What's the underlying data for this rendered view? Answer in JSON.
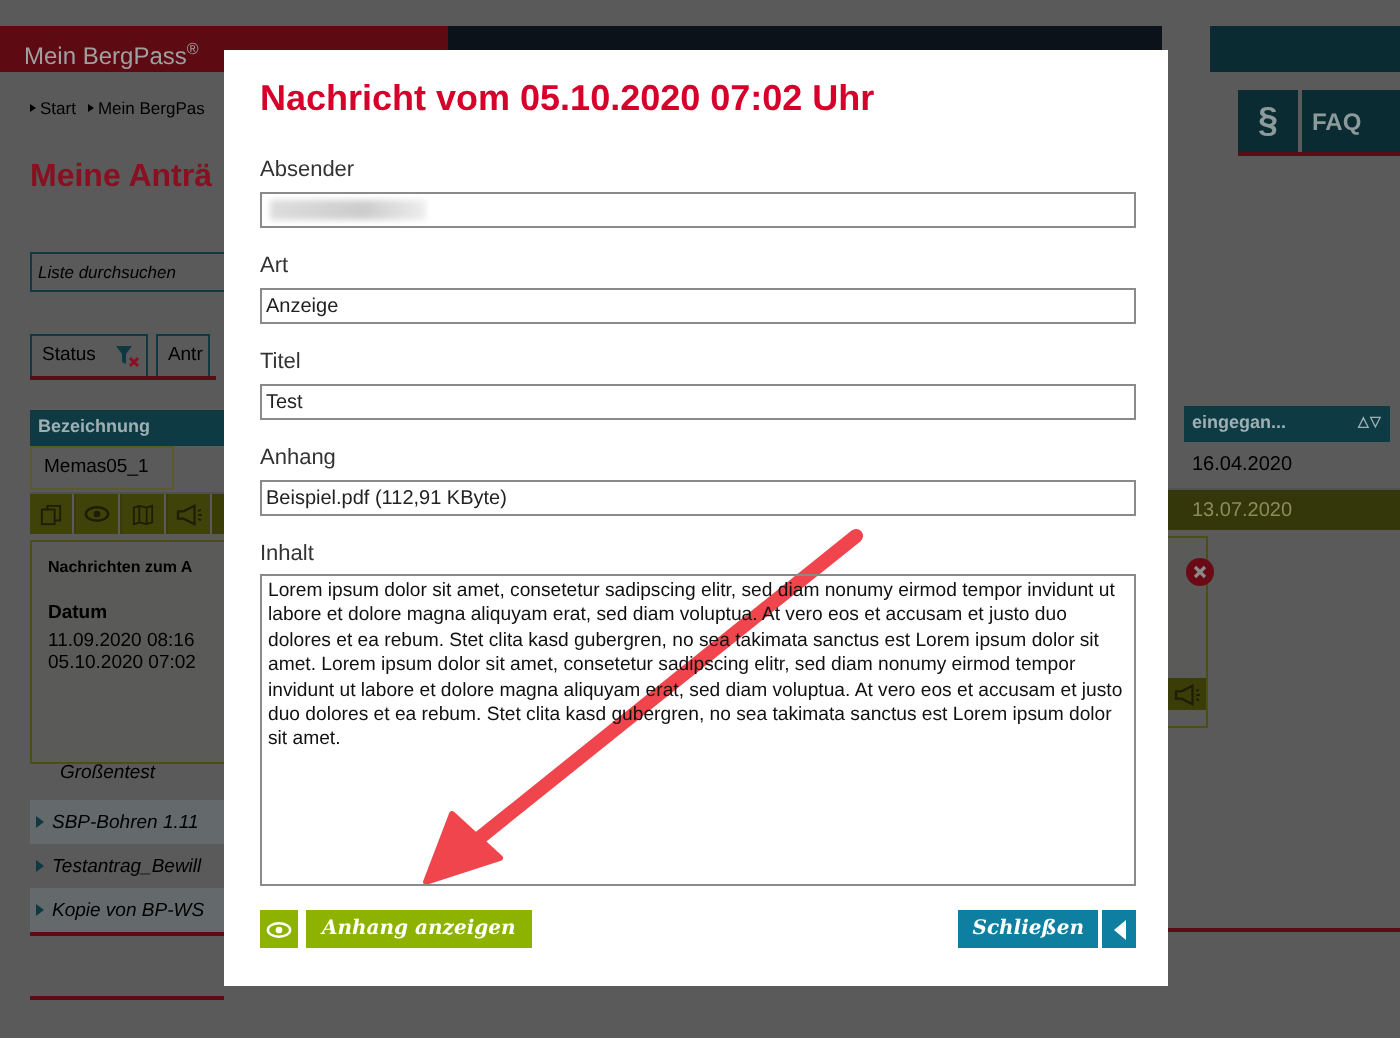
{
  "header": {
    "brand": "Mein BergPass$^{®}$",
    "tiles": [
      "§",
      "FAQ"
    ]
  },
  "breadcrumb": [
    "Start",
    "Mein BergPas"
  ],
  "page_title": "Meine Anträ",
  "search": {
    "placeholder": "Liste durchsuchen"
  },
  "filters": [
    {
      "label": "Status",
      "filtered": true
    },
    {
      "label": "Antr",
      "filtered": false
    }
  ],
  "table": {
    "columns": [
      "Bezeichnung",
      "eingegan..."
    ],
    "sort_icon": "△▽",
    "tooltip": "Memas05_1",
    "rows": [
      {
        "date": "16.04.2020",
        "selected": false
      },
      {
        "date": "13.07.2020",
        "selected": true
      }
    ],
    "more_rows": [
      {
        "name": "Großentest",
        "expandable": false
      },
      {
        "name": "SBP-Bohren 1.11",
        "expandable": true
      },
      {
        "name": "Testantrag_Bewill",
        "expandable": true
      },
      {
        "name": "Kopie von BP-WS",
        "expandable": true
      }
    ]
  },
  "messages_popup": {
    "title": "Nachrichten zum A",
    "column": "Datum",
    "dates": [
      "11.09.2020 08:16",
      "05.10.2020 07:02"
    ]
  },
  "dialog": {
    "title": "Nachricht vom 05.10.2020 07:02 Uhr",
    "fields": [
      {
        "label": "Absender",
        "redacted": true
      },
      {
        "label": "Art",
        "value": "Anzeige",
        "redacted": false
      },
      {
        "label": "Titel",
        "value": "Test",
        "redacted": false
      },
      {
        "label": "Anhang",
        "value": "Beispiel.pdf (112,91 KByte)",
        "redacted": false
      }
    ],
    "content": {
      "label": "Inhalt",
      "value": "Lorem ipsum dolor sit amet, consetetur sadipscing elitr, sed diam nonumy eirmod tempor invidunt ut labore et dolore magna aliquyam erat, sed diam voluptua. At vero eos et accusam et justo duo dolores et ea rebum. Stet clita kasd gubergren, no sea takimata sanctus est Lorem ipsum dolor sit amet. Lorem ipsum dolor sit amet, consetetur sadipscing elitr, sed diam nonumy eirmod tempor invidunt ut labore et dolore magna aliquyam erat, sed diam voluptua. At vero eos et accusam et justo duo dolores et ea rebum. Stet clita kasd gubergren, no sea takimata sanctus est Lorem ipsum dolor sit amet."
    },
    "primary_button": "Anhang anzeigen",
    "close_button": "Schließen"
  }
}
